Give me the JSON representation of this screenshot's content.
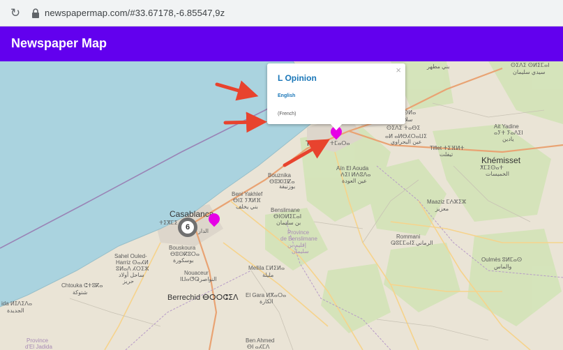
{
  "browser": {
    "url": "newspapermap.com/#33.67178,-6.85547,9z",
    "reload_icon": "reload-icon",
    "lock_icon": "lock-icon"
  },
  "app": {
    "title": "Newspaper Map",
    "header_color": "#6200ee"
  },
  "popup": {
    "title": "L Opinion",
    "language_link": "English",
    "note": "(French)",
    "close": "×"
  },
  "cluster": {
    "count": "6"
  },
  "map_labels": {
    "casablanca": "Casablanca",
    "casablanca_tif": "ⵜⵉⴳⵎⵉ",
    "casablanca_ar": "الدار",
    "temara": "Tém",
    "temara_tif": "ⵜⵎⴰⵔⴰ",
    "ain_el_aouda": "Aïn El Aouda",
    "ain_el_aouda_tif": "ⵄⵉⵏ ⵍⵄⵓⴷⴰ",
    "ain_el_aouda_ar": "عين العودة",
    "bouznika": "Bouznika",
    "bouznika_tif": "ⴱⵓⵣⵏⵉⵇⴰ",
    "bouznika_ar": "بوزنيقة",
    "beni_yakhlef": "Beni Yakhlef",
    "beni_yakhlef_tif": "ⴱⵏⵉ ⵢⵅⵍⴼ",
    "beni_yakhlef_ar": "بني يخلف",
    "benslimane": "Benslimane",
    "benslimane_tif": "ⴱⵏⵙⵍⵉⵎⴰⵏ",
    "benslimane_ar": "بن سليمان",
    "province_benslimane": "Province",
    "province_benslimane2": "de Benslimane",
    "province_benslimane_ar": "إقليم بن",
    "province_benslimane_ar2": "سليمان",
    "rommani": "Rommani",
    "rommani_tif": "ⵕⵓⵎⵎⴰⵏⵉ",
    "rommani_ar": "الرماني",
    "maaziz": "Maaziz ⵎⵄⵣⵉⵣ",
    "maaziz_ar": "معزيز",
    "khemisset": "Khémisset",
    "khemisset_tif": "ⵅⵎⵉⵙⴰⵜ",
    "khemisset_ar": "الخميسات",
    "ait_yadine": "Ait Yadine",
    "ait_yadine_tif": "ⴰⵢⵜ ⵢⴰⴷⵉⵏ",
    "ait_yadine_ar": "يادين",
    "tiflet": "Tiflet ⵜⵉⴼⵍⵜ",
    "tiflet_ar": "تيفلت",
    "sidi_slimane": "ⵙⵉⴷⵉ ⵙⵍⵉⵎⴰⵏ",
    "sidi_slimane_ar": "سيدي سليمان",
    "oulmes": "Oulmès ⵓⵍⵎⴰⵙ",
    "oulmes_ar": "والماس",
    "sahel_ouled_harriz": "Sahel Ouled-",
    "sahel_ouled_harriz2": "Harriz ⵙⴰⵃⵍ",
    "sahel_ouled_harriz3": "ⵓⵍⴰⴷ ⵃⵔⵉⵣ",
    "sahel_ouled_harriz_ar": "ساحل أولاد",
    "sahel_ouled_harriz_ar2": "حريز",
    "bouskoura": "Bouskoura",
    "bouskoura_tif": "ⴱⵓⵙⴽⵓⵔⴰ",
    "bouskoura_ar": "بوسكورة",
    "nouaceur": "Nouaceur",
    "nouaceur_tif": "ⵏⵡⴰⵚⵕ",
    "nouaceur_ar": "النواصر",
    "chtouka": "Chtouka ⵛⵜⵓⴽⴰ",
    "chtouka_ar": "شتوكة",
    "berrechid": "Berrechid ⴱⵔⵔⵛⵉⴷ",
    "el_gara": "El Gara ⵍⴳⴰⵔⴰ",
    "el_gara_ar": "الكارة",
    "mellila": "Mellila ⵎⵍⵉⵍⴰ",
    "mellila_ar": "مليلة",
    "ben_ahmed": "Ben Ahmed",
    "ben_ahmed_tif": "ⴱⵏ ⴰⵃⵎⴷ",
    "jadida": "ida ⵍⵊⴷⵉⴷⴰ",
    "jadida_ar": "الجديدة",
    "province_jadida": "Province",
    "province_jadida2": "d'El Jadida",
    "ar_top": "بني مطهر",
    "kenitra_area": "ⴰⵍ ⴰⵍⴱⵃⵔⴰⵡⵉ",
    "kenitra_area_ar": "عين البحراوي",
    "sale_area": "ⵙⵍⴰ",
    "sale_area_ar": "سلا",
    "sale_area2": "ⵙⵉⴷⵉ ⵜⴰⴱⵉ"
  }
}
